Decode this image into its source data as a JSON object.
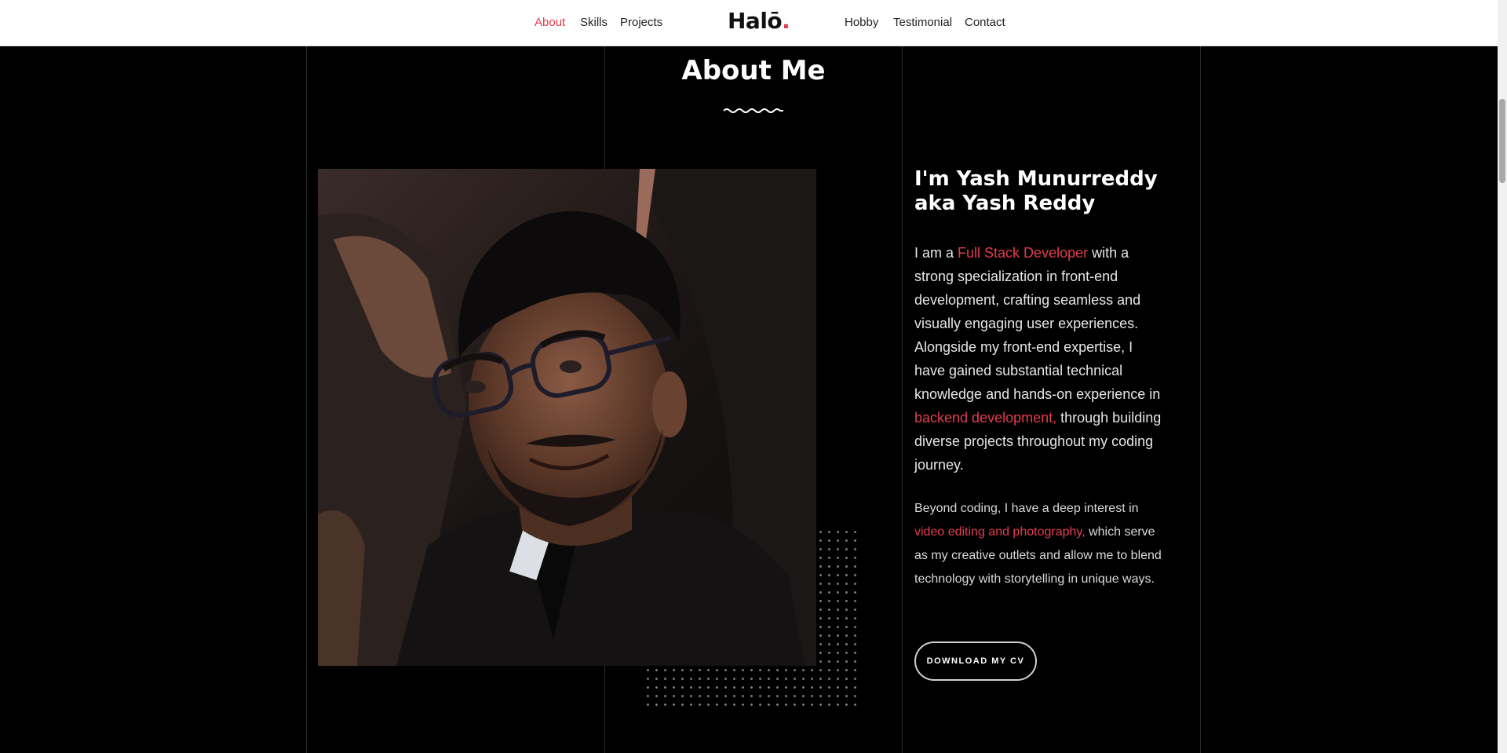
{
  "nav": {
    "left_links": [
      "About",
      "Skills",
      "Projects"
    ],
    "right_links": [
      "Hobby",
      "Testimonial",
      "Contact"
    ],
    "active": "About",
    "logo_text": "Halō",
    "logo_dot": "."
  },
  "section": {
    "title": "About Me"
  },
  "about": {
    "heading": "I'm Yash Munurreddy aka Yash Reddy",
    "p1_intro": "I am a ",
    "p1_role": "Full Stack Developer",
    "p1_mid": " with a strong specialization in front-end development, crafting seamless and visually engaging user experiences. Alongside my front-end expertise, I have gained substantial technical knowledge and hands-on experience in ",
    "p1_backend": "backend development,",
    "p1_end": " through building diverse projects throughout my coding journey.",
    "p2_intro": "Beyond coding, I have a deep interest in ",
    "p2_interest": "video editing and photography,",
    "p2_end": " which serve as my creative outlets and allow me to blend technology with storytelling in unique ways.",
    "cv_button": "DOWNLOAD MY CV"
  },
  "colors": {
    "accent": "#e33b4e",
    "background": "#000000",
    "navbar": "#ffffff"
  }
}
